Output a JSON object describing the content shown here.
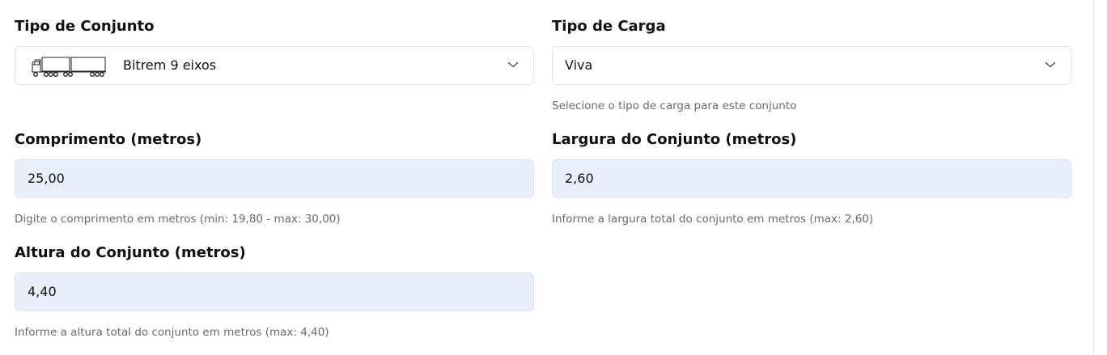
{
  "tipo_conjunto": {
    "label": "Tipo de Conjunto",
    "selected": "Bitrem 9 eixos",
    "icon": "truck-icon"
  },
  "tipo_carga": {
    "label": "Tipo de Carga",
    "selected": "Viva",
    "helper": "Selecione o tipo de carga para este conjunto"
  },
  "comprimento": {
    "label": "Comprimento (metros)",
    "value": "25,00",
    "helper": "Digite o comprimento em metros (min: 19,80 - max: 30,00)"
  },
  "largura": {
    "label": "Largura do Conjunto (metros)",
    "value": "2,60",
    "helper": "Informe a largura total do conjunto em metros (max: 2,60)"
  },
  "altura": {
    "label": "Altura do Conjunto (metros)",
    "value": "4,40",
    "helper": "Informe a altura total do conjunto em metros (max: 4,40)"
  },
  "colors": {
    "input_background": "#e8effb",
    "border": "#e4e5e9",
    "helper_text": "#6b6b6b"
  }
}
